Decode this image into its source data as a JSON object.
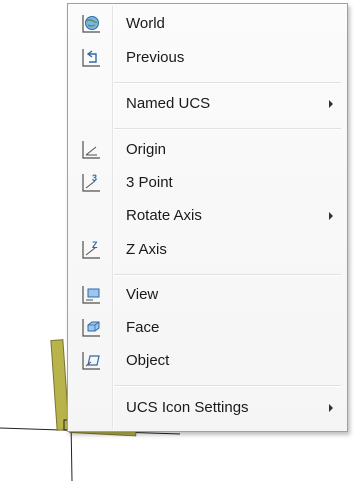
{
  "menu": {
    "items": [
      {
        "label": "World",
        "icon": "world-ucs-icon",
        "submenu": false
      },
      {
        "label": "Previous",
        "icon": "previous-ucs-icon",
        "submenu": false
      },
      {
        "label": "Named UCS",
        "icon": "",
        "submenu": true
      },
      {
        "label": "Origin",
        "icon": "origin-ucs-icon",
        "submenu": false
      },
      {
        "label": "3 Point",
        "icon": "three-point-ucs-icon",
        "submenu": false
      },
      {
        "label": "Rotate Axis",
        "icon": "",
        "submenu": true
      },
      {
        "label": "Z Axis",
        "icon": "z-axis-ucs-icon",
        "submenu": false
      },
      {
        "label": "View",
        "icon": "view-ucs-icon",
        "submenu": false
      },
      {
        "label": "Face",
        "icon": "face-ucs-icon",
        "submenu": false
      },
      {
        "label": "Object",
        "icon": "object-ucs-icon",
        "submenu": false
      },
      {
        "label": "UCS Icon Settings",
        "icon": "",
        "submenu": true
      }
    ]
  },
  "colors": {
    "icon_blue": "#3a78c8",
    "icon_dark": "#404040",
    "ucs_bg_yellow": "#c8c24a"
  }
}
